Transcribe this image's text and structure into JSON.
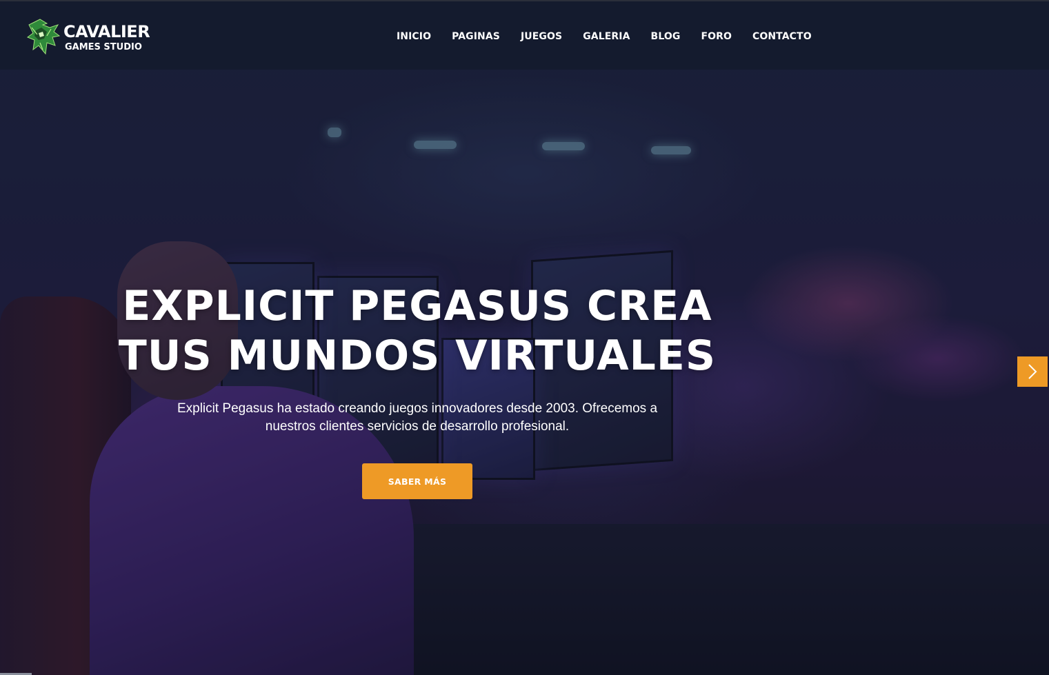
{
  "brand": {
    "name": "CAVALIER",
    "subtitle": "GAMES STUDIO",
    "logo_icon": "dragon-head-icon"
  },
  "nav": {
    "items": [
      {
        "label": "INICIO"
      },
      {
        "label": "PAGINAS"
      },
      {
        "label": "JUEGOS"
      },
      {
        "label": "GALERIA"
      },
      {
        "label": "BLOG"
      },
      {
        "label": "FORO"
      },
      {
        "label": "CONTACTO"
      }
    ]
  },
  "hero": {
    "title_line1": "EXPLICIT PEGASUS CREA",
    "title_line2": "TUS MUNDOS VIRTUALES",
    "description": "Explicit Pegasus ha estado creando juegos innovadores desde 2003. Ofrecemos a nuestros clientes servicios de desarrollo profesional.",
    "cta_label": "SABER MÁS",
    "next_icon": "chevron-right-icon"
  },
  "colors": {
    "accent": "#ee9a26",
    "header_bg": "#141b2d",
    "text": "#ffffff"
  }
}
